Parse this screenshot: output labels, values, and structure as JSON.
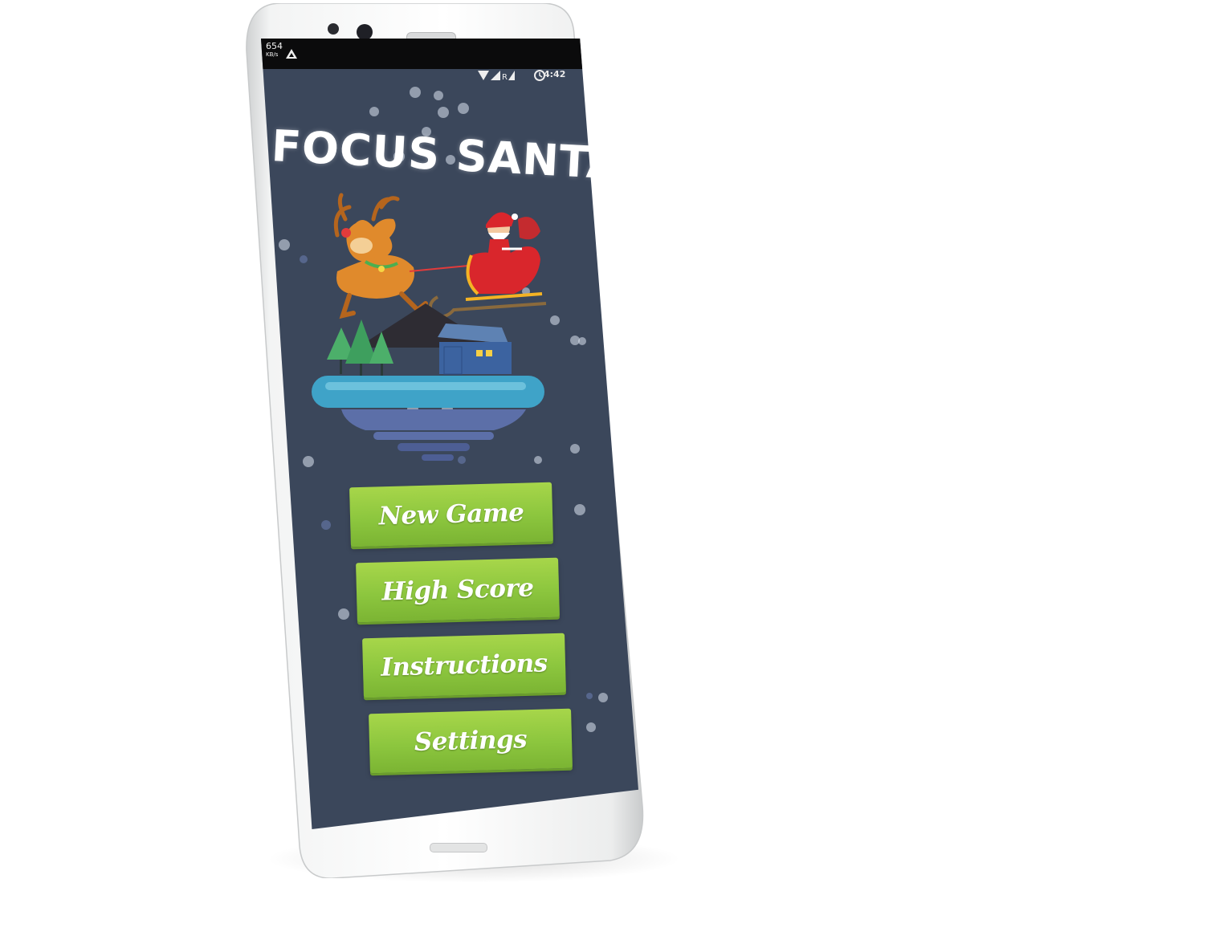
{
  "status_bar": {
    "speed_value": "654",
    "speed_unit": "KB/s",
    "time": "4:42"
  },
  "app": {
    "title": "FOCUS SANTA"
  },
  "menu": {
    "new_game": "New Game",
    "high_score": "High Score",
    "instructions": "Instructions",
    "settings": "Settings"
  },
  "colors": {
    "screen_bg": "#3b475b",
    "button_green": "#8cc63e",
    "phone_body": "#f4f5f5"
  },
  "icons": [
    "drive-icon",
    "wifi-icon",
    "signal-icon",
    "battery-icon"
  ]
}
